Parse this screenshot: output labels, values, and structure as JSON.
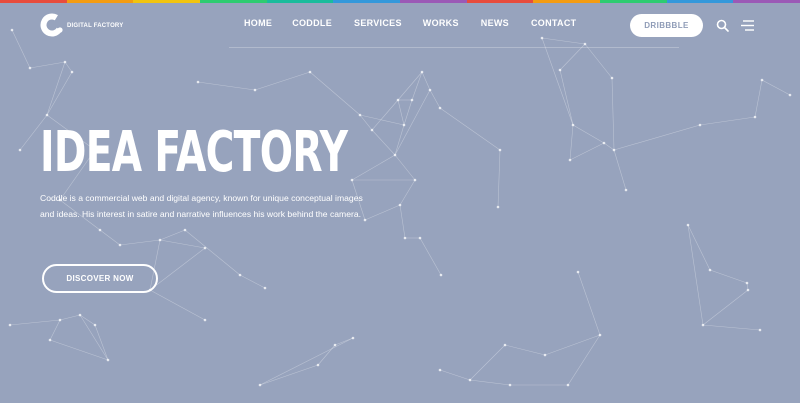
{
  "colors": {
    "background": "#97a3bd",
    "accent_text": "#ffffff",
    "rainbow": [
      "#e84c3d",
      "#f39c12",
      "#f1c40f",
      "#2ecc71",
      "#1abc9c",
      "#3498db",
      "#9b59b6",
      "#e84c3d",
      "#f39c12",
      "#2ecc71",
      "#3498db",
      "#9b59b6"
    ]
  },
  "header": {
    "logo_text": "DIGITAL FACTORY",
    "nav": [
      {
        "label": "HOME"
      },
      {
        "label": "CODDLE"
      },
      {
        "label": "SERVICES"
      },
      {
        "label": "WORKS"
      },
      {
        "label": "NEWS"
      },
      {
        "label": "CONTACT"
      }
    ],
    "cta_label": "DRIBBBLE",
    "icons": {
      "search": "search-icon",
      "menu": "hamburger-menu-icon"
    }
  },
  "hero": {
    "title": "IDEA FACTORY",
    "description": "Coddle is a commercial web and digital agency, known for unique conceptual images and ideas. His interest in satire and narrative influences his work behind the camera.",
    "button_label": "DISCOVER NOW"
  }
}
